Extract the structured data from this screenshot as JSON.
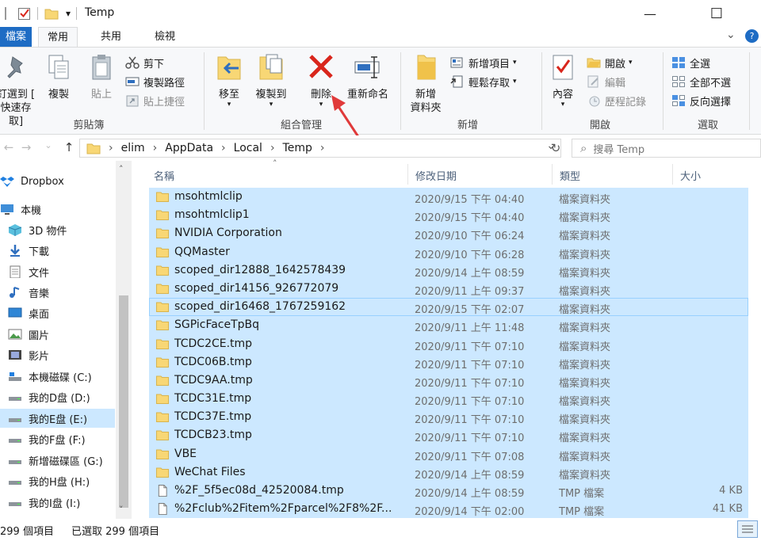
{
  "window": {
    "title": "Temp",
    "quick_access_dropdown": "▾",
    "minimize_glyph": "—",
    "maximize_glyph": "☐",
    "close_glyph": "✕"
  },
  "tabs": {
    "file": "檔案",
    "home": "常用",
    "share": "共用",
    "view": "檢視",
    "expand_glyph": "⌄",
    "help_glyph": "?"
  },
  "ribbon": {
    "clipboard": {
      "pin_label_line1": "釘選到 [",
      "pin_label_line2": "快速存取]",
      "copy_label": "複製",
      "paste_label": "貼上",
      "cut_label": "剪下",
      "copy_path_label": "複製路徑",
      "paste_shortcut_label": "貼上捷徑",
      "group_label": "剪貼簿"
    },
    "organize": {
      "move_to_label": "移至",
      "copy_to_label": "複製到",
      "delete_label": "刪除",
      "rename_label": "重新命名",
      "group_label": "組合管理"
    },
    "new": {
      "new_folder_line1": "新增",
      "new_folder_line2": "資料夾",
      "new_item_label": "新增項目",
      "easy_access_label": "輕鬆存取",
      "group_label": "新增"
    },
    "open": {
      "properties_label": "內容",
      "open_label": "開啟",
      "edit_label": "編輯",
      "history_label": "歷程記錄",
      "group_label": "開啟"
    },
    "select": {
      "select_all_label": "全選",
      "select_none_label": "全部不選",
      "invert_label": "反向選擇",
      "group_label": "選取"
    }
  },
  "address": {
    "back_glyph": "←",
    "forward_glyph": "→",
    "up_glyph": "↑",
    "breadcrumb": [
      "elim",
      "AppData",
      "Local",
      "Temp"
    ],
    "separator": "›",
    "dropdown_glyph": "⌄",
    "refresh_glyph": "↻",
    "search_placeholder": "搜尋 Temp"
  },
  "nav": {
    "items": [
      {
        "label": "Dropbox",
        "icon": "dropbox-icon"
      },
      {
        "label": "本機",
        "icon": "pc-icon"
      },
      {
        "label": "3D 物件",
        "icon": "3d-objects-icon"
      },
      {
        "label": "下載",
        "icon": "download-icon"
      },
      {
        "label": "文件",
        "icon": "documents-icon"
      },
      {
        "label": "音樂",
        "icon": "music-icon"
      },
      {
        "label": "桌面",
        "icon": "desktop-icon"
      },
      {
        "label": "圖片",
        "icon": "pictures-icon"
      },
      {
        "label": "影片",
        "icon": "videos-icon"
      },
      {
        "label": "本機磁碟 (C:)",
        "icon": "system-drive-icon"
      },
      {
        "label": "我的D盘 (D:)",
        "icon": "drive-icon"
      },
      {
        "label": "我的E盘 (E:)",
        "icon": "drive-icon",
        "selected": true
      },
      {
        "label": "我的F盘 (F:)",
        "icon": "drive-icon"
      },
      {
        "label": "新增磁碟區 (G:)",
        "icon": "drive-icon"
      },
      {
        "label": "我的H盘 (H:)",
        "icon": "drive-icon"
      },
      {
        "label": "我的I盘 (I:)",
        "icon": "drive-icon"
      }
    ],
    "scroll_up_glyph": "˄",
    "scroll_down_glyph": "˅"
  },
  "columns": {
    "name": "名稱",
    "date": "修改日期",
    "type": "類型",
    "size": "大小",
    "sort_glyph": "˄"
  },
  "files": [
    {
      "name": "msohtmlclip",
      "date": "2020/9/15 下午 04:40",
      "type": "檔案資料夾",
      "size": "",
      "kind": "folder"
    },
    {
      "name": "msohtmlclip1",
      "date": "2020/9/15 下午 04:40",
      "type": "檔案資料夾",
      "size": "",
      "kind": "folder"
    },
    {
      "name": "NVIDIA Corporation",
      "date": "2020/9/10 下午 06:24",
      "type": "檔案資料夾",
      "size": "",
      "kind": "folder"
    },
    {
      "name": "QQMaster",
      "date": "2020/9/10 下午 06:28",
      "type": "檔案資料夾",
      "size": "",
      "kind": "folder"
    },
    {
      "name": "scoped_dir12888_1642578439",
      "date": "2020/9/14 上午 08:59",
      "type": "檔案資料夾",
      "size": "",
      "kind": "folder"
    },
    {
      "name": "scoped_dir14156_926772079",
      "date": "2020/9/11 上午 09:37",
      "type": "檔案資料夾",
      "size": "",
      "kind": "folder"
    },
    {
      "name": "scoped_dir16468_1767259162",
      "date": "2020/9/15 下午 02:07",
      "type": "檔案資料夾",
      "size": "",
      "kind": "folder",
      "focus": true
    },
    {
      "name": "SGPicFaceTpBq",
      "date": "2020/9/11 上午 11:48",
      "type": "檔案資料夾",
      "size": "",
      "kind": "folder"
    },
    {
      "name": "TCDC2CE.tmp",
      "date": "2020/9/11 下午 07:10",
      "type": "檔案資料夾",
      "size": "",
      "kind": "folder"
    },
    {
      "name": "TCDC06B.tmp",
      "date": "2020/9/11 下午 07:10",
      "type": "檔案資料夾",
      "size": "",
      "kind": "folder"
    },
    {
      "name": "TCDC9AA.tmp",
      "date": "2020/9/11 下午 07:10",
      "type": "檔案資料夾",
      "size": "",
      "kind": "folder"
    },
    {
      "name": "TCDC31E.tmp",
      "date": "2020/9/11 下午 07:10",
      "type": "檔案資料夾",
      "size": "",
      "kind": "folder"
    },
    {
      "name": "TCDC37E.tmp",
      "date": "2020/9/11 下午 07:10",
      "type": "檔案資料夾",
      "size": "",
      "kind": "folder"
    },
    {
      "name": "TCDCB23.tmp",
      "date": "2020/9/11 下午 07:10",
      "type": "檔案資料夾",
      "size": "",
      "kind": "folder"
    },
    {
      "name": "VBE",
      "date": "2020/9/11 下午 07:08",
      "type": "檔案資料夾",
      "size": "",
      "kind": "folder"
    },
    {
      "name": "WeChat Files",
      "date": "2020/9/14 上午 08:59",
      "type": "檔案資料夾",
      "size": "",
      "kind": "folder"
    },
    {
      "name": "%2F_5f5ec08d_42520084.tmp",
      "date": "2020/9/14 上午 08:59",
      "type": "TMP 檔案",
      "size": "4 KB",
      "kind": "file"
    },
    {
      "name": "%2Fclub%2Fitem%2Fparcel%2F8%2F...",
      "date": "2020/9/14 下午 02:00",
      "type": "TMP 檔案",
      "size": "41 KB",
      "kind": "file"
    }
  ],
  "status": {
    "item_count": "299 個項目",
    "selected_count": "已選取 299 個項目"
  },
  "colors": {
    "accent": "#1e6cc4",
    "selection": "#cce8ff",
    "folder": "#f8d775",
    "delete_red": "#d9261c",
    "annotation_red": "#e03a3a"
  }
}
